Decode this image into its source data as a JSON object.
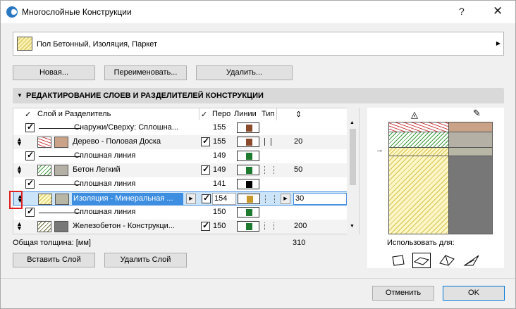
{
  "window": {
    "title": "Многослойные Конструкции",
    "help": "?",
    "close": "✕"
  },
  "composite": {
    "name": "Пол Бетонный, Изоляция, Паркет"
  },
  "buttons": {
    "new": "Новая...",
    "rename": "Переименовать...",
    "delete": "Удалить...",
    "insert_layer": "Вставить Слой",
    "delete_layer": "Удалить Слой",
    "cancel": "Отменить",
    "ok": "OK"
  },
  "section": {
    "title": "РЕДАКТИРОВАНИЕ СЛОЕВ И РАЗДЕЛИТЕЛЕЙ КОНСТРУКЦИИ"
  },
  "columns": {
    "layer": "Слой и Разделитель",
    "pen": "Перо",
    "lines": "Линии",
    "type": "Тип",
    "thickness_icon": "⇕"
  },
  "rows": [
    {
      "kind": "sep",
      "name": "Снаружи/Сверху: Сплошна...",
      "pen": "155",
      "color": "#8b4a2b"
    },
    {
      "kind": "layer",
      "name": "Дерево - Половая Доска",
      "pen": "155",
      "color": "#8b4a2b",
      "thick": "20"
    },
    {
      "kind": "sep",
      "name": "Сплошная линия",
      "pen": "149",
      "color": "#1e7a2e"
    },
    {
      "kind": "layer",
      "name": "Бетон Легкий",
      "pen": "149",
      "color": "#1e7a2e",
      "thick": "50"
    },
    {
      "kind": "sep",
      "name": "Сплошная линия",
      "pen": "141",
      "color": "#000000"
    },
    {
      "kind": "layer",
      "name": "Изоляция - Минеральная ...",
      "pen": "154",
      "color": "#c9982a",
      "thick": "30",
      "selected": true
    },
    {
      "kind": "sep",
      "name": "Сплошная линия",
      "pen": "150",
      "color": "#1e7a2e"
    },
    {
      "kind": "layer",
      "name": "Железобетон - Конструкци...",
      "pen": "150",
      "color": "#1e7a2e",
      "thick": "200"
    }
  ],
  "total": {
    "label": "Общая толщина: [мм]",
    "value": "310"
  },
  "use_for": {
    "label": "Использовать для:"
  }
}
